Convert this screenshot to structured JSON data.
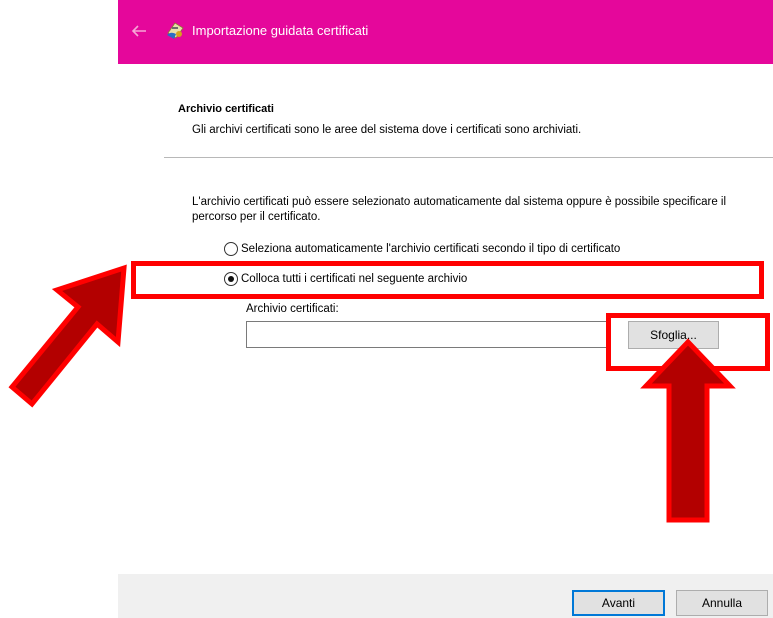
{
  "window": {
    "title": "Importazione guidata certificati",
    "back_icon": "back-arrow-icon",
    "app_icon": "certificate-icon",
    "titlebar_color": "#e5079b"
  },
  "section": {
    "heading": "Archivio certificati",
    "description": "Gli archivi certificati sono le aree del sistema dove i certificati sono archiviati."
  },
  "content": {
    "intro": "L'archivio certificati può essere selezionato automaticamente dal sistema oppure è possibile specificare il percorso per il certificato.",
    "options": [
      {
        "label": "Seleziona automaticamente l'archivio certificati secondo il tipo di certificato",
        "selected": false
      },
      {
        "label": "Colloca tutti i certificati nel seguente archivio",
        "selected": true
      }
    ],
    "store_label": "Archivio certificati:",
    "store_value": "",
    "browse_label": "Sfoglia..."
  },
  "footer": {
    "next_label": "Avanti",
    "cancel_label": "Annulla"
  },
  "annotations": {
    "color": "#ff0000",
    "dark_fill": "#b30000"
  }
}
